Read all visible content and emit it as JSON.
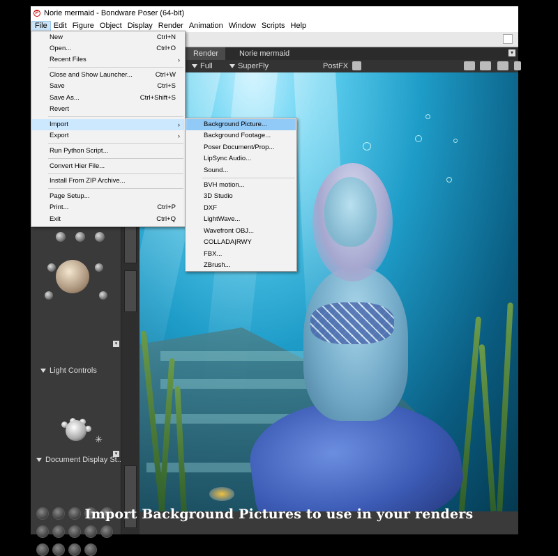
{
  "window": {
    "title": "Norie mermaid - Bondware Poser (64-bit)",
    "app_icon": "poser-logo-icon"
  },
  "menubar": {
    "items": [
      "File",
      "Edit",
      "Figure",
      "Object",
      "Display",
      "Render",
      "Animation",
      "Window",
      "Scripts",
      "Help"
    ],
    "active": "File"
  },
  "tabs": {
    "render": "Render",
    "document": "Norie mermaid"
  },
  "render_toolbar": {
    "size": "Full",
    "engine": "SuperFly",
    "postfx": "PostFX"
  },
  "left_panel": {
    "light_controls": "Light Controls",
    "document_display": "Document Display St..."
  },
  "file_menu": {
    "items": [
      {
        "label": "New",
        "shortcut": "Ctrl+N"
      },
      {
        "label": "Open...",
        "shortcut": "Ctrl+O"
      },
      {
        "label": "Recent Files",
        "submenu": "›"
      },
      {
        "label": "Close and Show Launcher...",
        "shortcut": "Ctrl+W"
      },
      {
        "label": "Save",
        "shortcut": "Ctrl+S"
      },
      {
        "label": "Save As...",
        "shortcut": "Ctrl+Shift+S"
      },
      {
        "label": "Revert"
      },
      {
        "label": "Import",
        "submenu": "›"
      },
      {
        "label": "Export",
        "submenu": "›"
      },
      {
        "label": "Run Python Script..."
      },
      {
        "label": "Convert Hier File..."
      },
      {
        "label": "Install From ZIP Archive..."
      },
      {
        "label": "Page Setup..."
      },
      {
        "label": "Print...",
        "shortcut": "Ctrl+P"
      },
      {
        "label": "Exit",
        "shortcut": "Ctrl+Q"
      }
    ]
  },
  "import_menu": {
    "items": [
      "Background Picture...",
      "Background Footage...",
      "Poser Document/Prop...",
      "LipSync Audio...",
      "Sound...",
      "BVH motion...",
      "3D Studio",
      "DXF",
      "LightWave...",
      "Wavefront OBJ...",
      "COLLADA|RWY",
      "FBX...",
      "ZBrush..."
    ]
  },
  "caption": "Import Background Pictures to use in your renders",
  "colors": {
    "menu_highlight": "#91c9f7",
    "menubar_active": "#cce4f7",
    "panel_bg": "#3a3a3a"
  }
}
